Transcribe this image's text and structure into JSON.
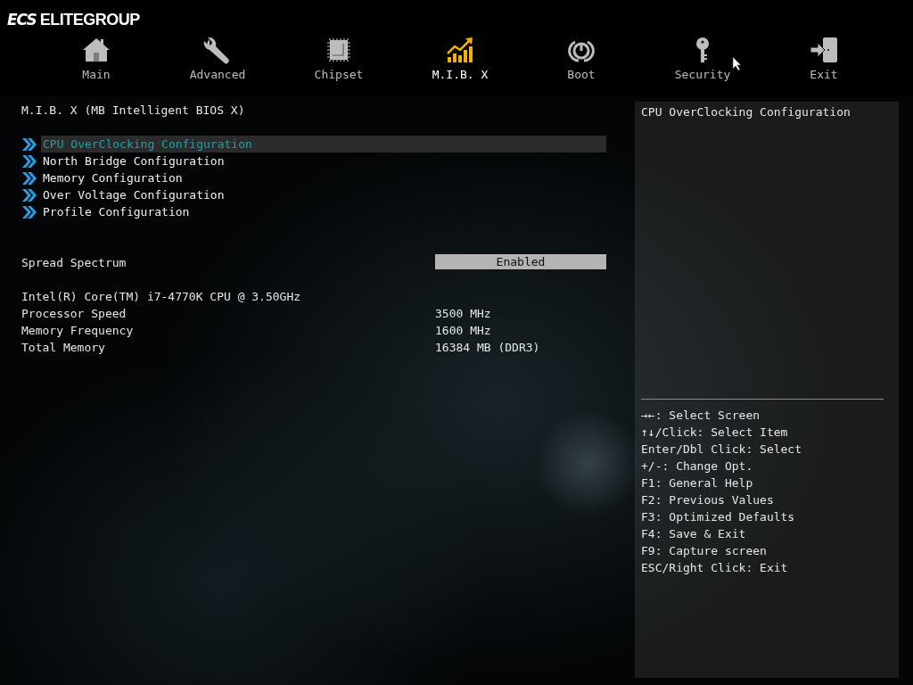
{
  "brand": {
    "mark": "ECS",
    "name": "ELITEGROUP"
  },
  "tabs": [
    {
      "label": "Main",
      "kind": "home",
      "selected": false
    },
    {
      "label": "Advanced",
      "kind": "wrench",
      "selected": false
    },
    {
      "label": "Chipset",
      "kind": "chip",
      "selected": false
    },
    {
      "label": "M.I.B. X",
      "kind": "chart",
      "selected": true
    },
    {
      "label": "Boot",
      "kind": "power",
      "selected": false
    },
    {
      "label": "Security",
      "kind": "key",
      "selected": false
    },
    {
      "label": "Exit",
      "kind": "door",
      "selected": false
    }
  ],
  "page_title": "M.I.B. X (MB Intelligent BIOS X)",
  "submenus": [
    {
      "label": "CPU OverClocking Configuration",
      "selected": true
    },
    {
      "label": "North Bridge Configuration",
      "selected": false
    },
    {
      "label": "Memory Configuration",
      "selected": false
    },
    {
      "label": "Over Voltage Configuration",
      "selected": false
    },
    {
      "label": "Profile Configuration",
      "selected": false
    }
  ],
  "settings": [
    {
      "label": "Spread Spectrum",
      "value": "Enabled"
    }
  ],
  "info": [
    {
      "label": "Intel(R) Core(TM) i7-4770K CPU @ 3.50GHz"
    },
    {
      "label": "Processor Speed",
      "value": "3500 MHz"
    },
    {
      "label": "Memory Frequency",
      "value": "1600 MHz"
    },
    {
      "label": "Total Memory",
      "value": "16384 MB (DDR3)"
    }
  ],
  "help": {
    "description": "CPU OverClocking Configuration",
    "keys": [
      "→←: Select Screen",
      "↑↓/Click: Select Item",
      "Enter/Dbl Click: Select",
      "+/-: Change Opt.",
      "F1: General Help",
      "F2: Previous Values",
      "F3: Optimized Defaults",
      "F4: Save & Exit",
      "F9: Capture screen",
      "ESC/Right Click: Exit"
    ]
  }
}
